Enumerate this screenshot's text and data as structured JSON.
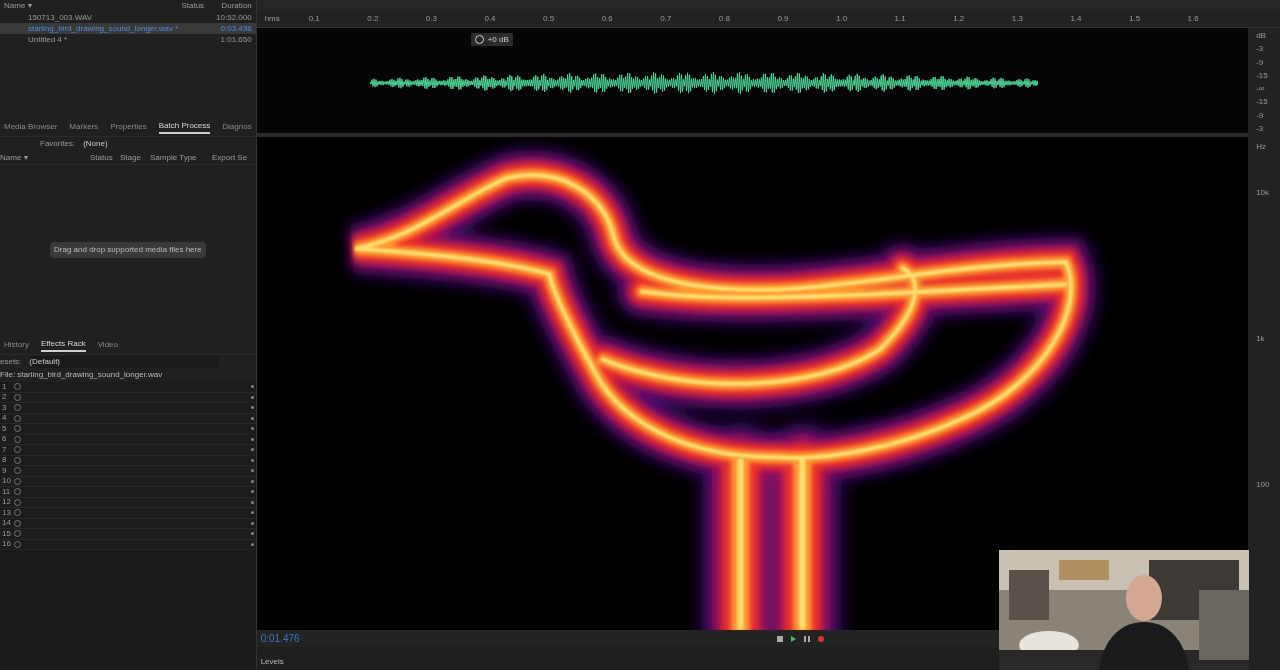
{
  "files": {
    "columns": [
      "Name ▾",
      "Status",
      "Duration"
    ],
    "rows": [
      {
        "name": "150713_003.WAV",
        "duration": "10:52.000",
        "selected": false
      },
      {
        "name": "starling_bird_drawing_sound_longer.wav *",
        "duration": "0:03.436",
        "selected": true
      },
      {
        "name": "Untitled 4 *",
        "duration": "1:01.650",
        "selected": false
      }
    ]
  },
  "panel_tabs": [
    {
      "label": "Media Browser",
      "selected": false
    },
    {
      "label": "Markers",
      "selected": false
    },
    {
      "label": "Properties",
      "selected": false
    },
    {
      "label": "Batch Process",
      "selected": true
    },
    {
      "label": "Diagnos",
      "selected": false
    }
  ],
  "batch": {
    "favorites_label": "Favorites:",
    "favorites_value": "(None)",
    "columns": [
      "Name ▾",
      "Status",
      "Stage",
      "Sample Type",
      "Export Se"
    ],
    "drop_hint": "Drag and drop supported media files here"
  },
  "rack_tabs": [
    {
      "label": "History",
      "selected": false
    },
    {
      "label": "Effects Rack",
      "selected": true
    },
    {
      "label": "Video",
      "selected": false
    }
  ],
  "rack": {
    "presets_label": "esets:",
    "presets_value": "(Default)",
    "file": "File: starling_bird_drawing_sound_longer.wav",
    "slots": [
      "1",
      "2",
      "3",
      "4",
      "5",
      "6",
      "7",
      "8",
      "9",
      "10",
      "11",
      "12",
      "13",
      "14",
      "15",
      "16"
    ]
  },
  "ruler": {
    "unit": "hms",
    "ticks": [
      "0.1",
      "0.2",
      "0.3",
      "0.4",
      "0.5",
      "0.6",
      "0.7",
      "0.8",
      "0.9",
      "1.0",
      "1.1",
      "1.2",
      "1.3",
      "1.4",
      "1.5",
      "1.6"
    ]
  },
  "volume": "+0 dB",
  "db_scale": {
    "unit": "dB",
    "labels": [
      "-3",
      "-9",
      "-15",
      "-∞",
      "-15",
      "-9",
      "-3"
    ]
  },
  "hz_scale": {
    "unit": "Hz",
    "labels": [
      "10k",
      "1k",
      "100"
    ]
  },
  "time": "0:01.476",
  "levels_title": "Levels"
}
